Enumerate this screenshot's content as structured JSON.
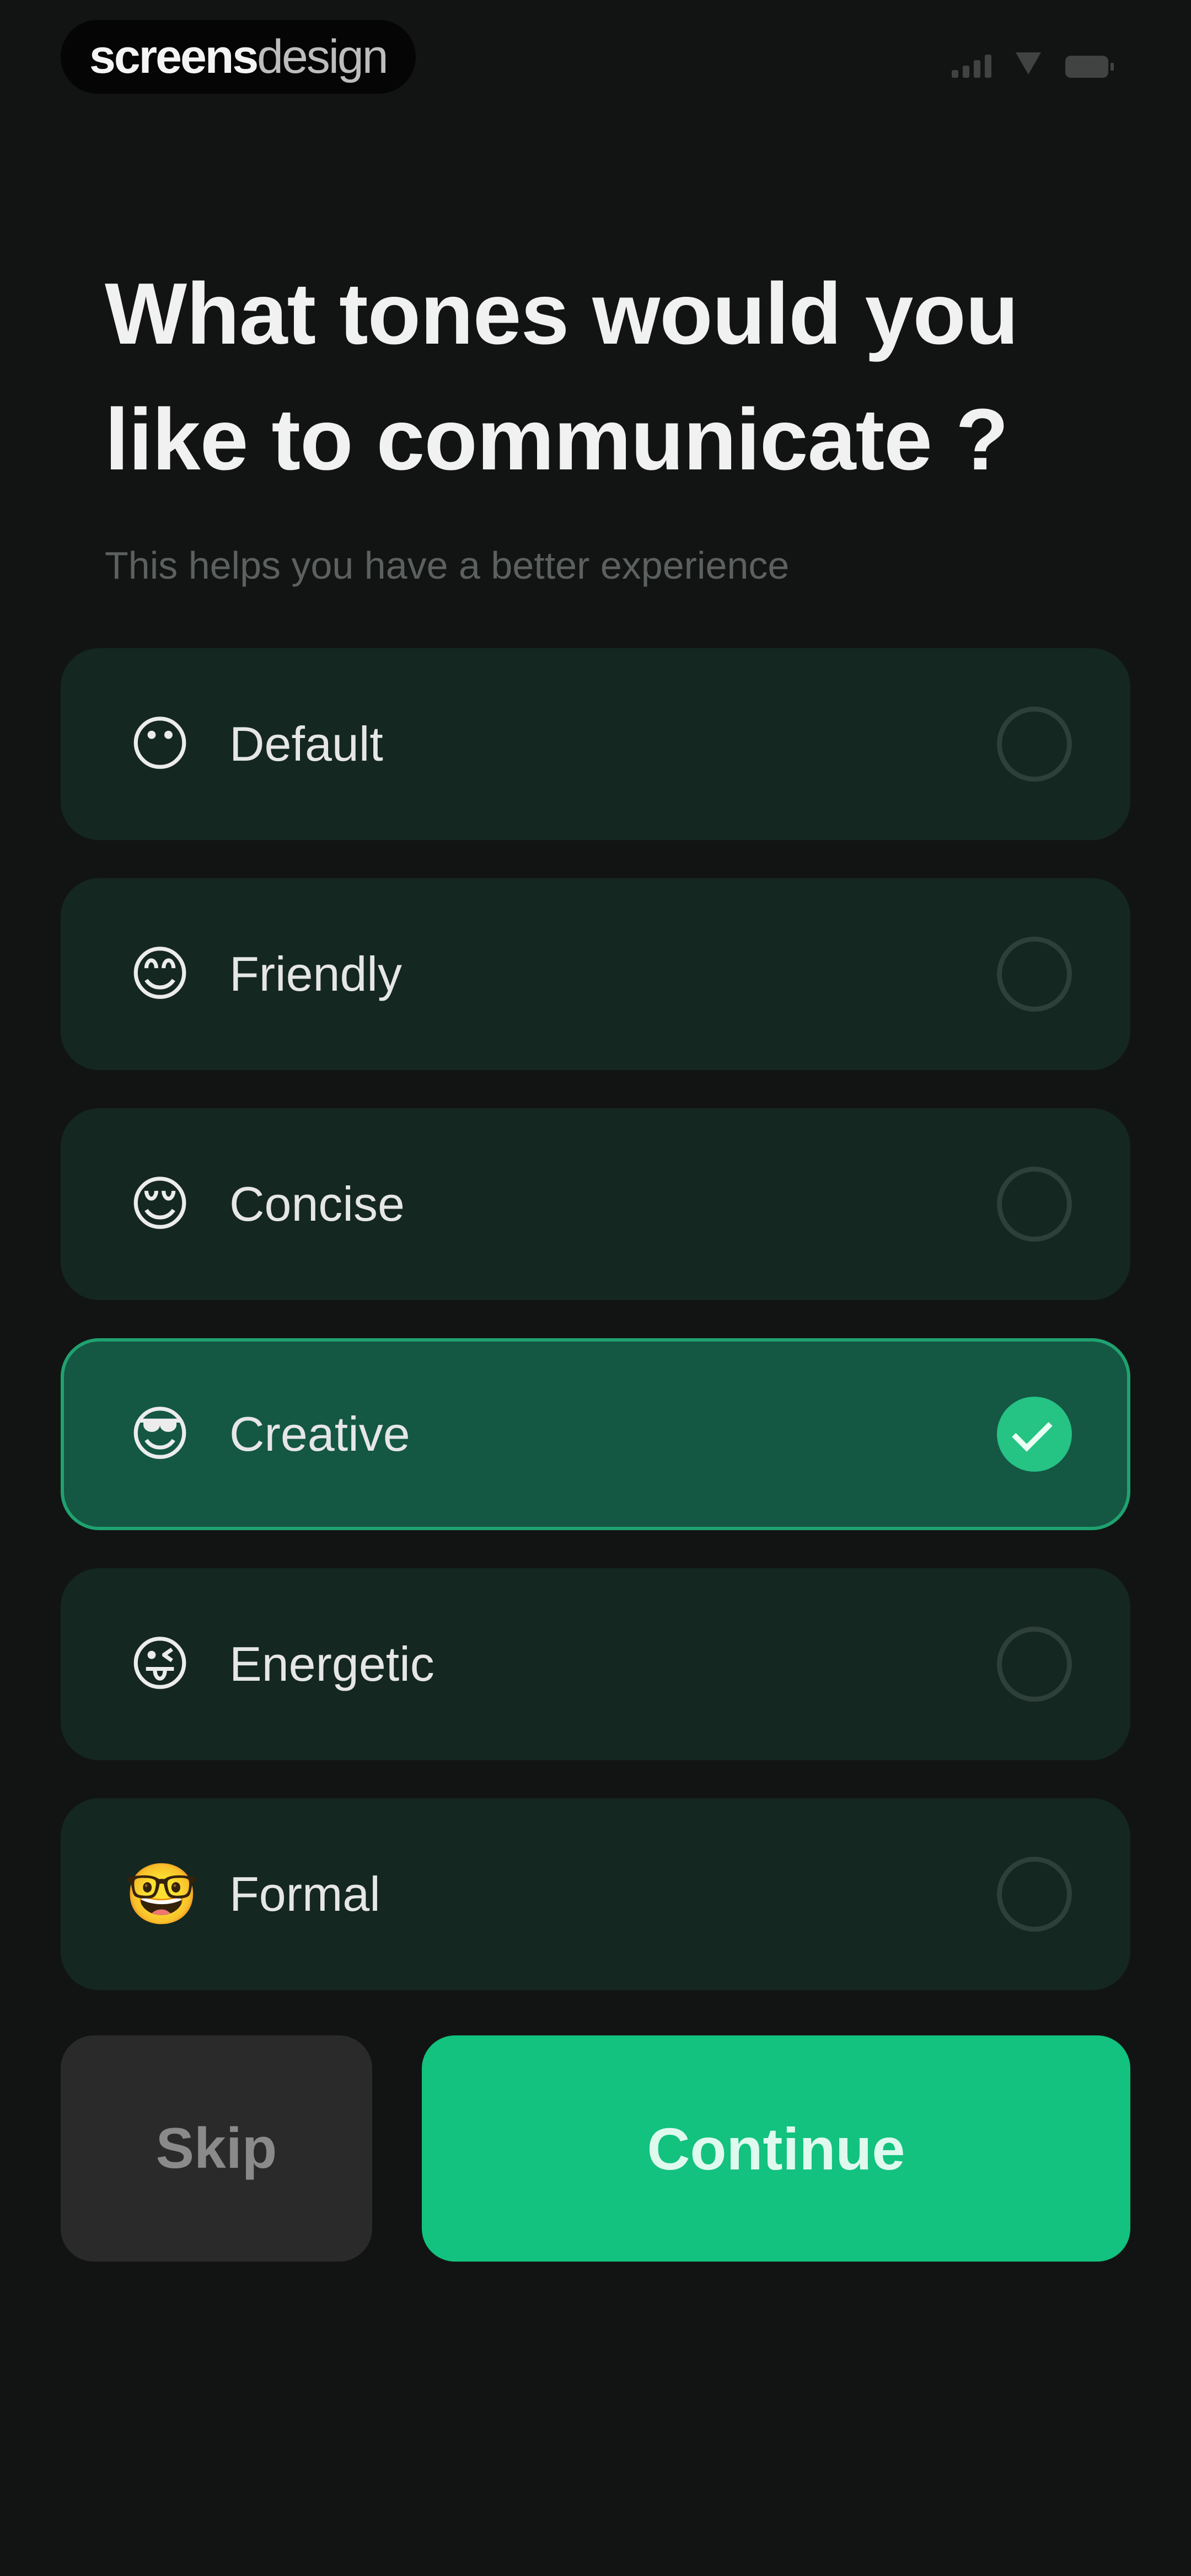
{
  "status_bar": {
    "brand_bold": "screens",
    "brand_light": "design",
    "icons": [
      "signal-icon",
      "wifi-icon",
      "battery-icon"
    ]
  },
  "header": {
    "title": "What tones would you like to communicate ?",
    "subtitle": "This helps you have a better experience"
  },
  "options": [
    {
      "label": "Default",
      "emoji": "😶",
      "selected": false
    },
    {
      "label": "Friendly",
      "emoji": "😊",
      "selected": false
    },
    {
      "label": "Concise",
      "emoji": "😌",
      "selected": false
    },
    {
      "label": "Creative",
      "emoji": "😎",
      "selected": true
    },
    {
      "label": "Energetic",
      "emoji": "😜",
      "selected": false
    },
    {
      "label": "Formal",
      "emoji": "🤓",
      "selected": false
    }
  ],
  "actions": {
    "skip_label": "Skip",
    "continue_label": "Continue"
  },
  "colors": {
    "background": "#121413",
    "card": "#142720",
    "card_selected": "#145743",
    "accent": "#12c27e"
  }
}
